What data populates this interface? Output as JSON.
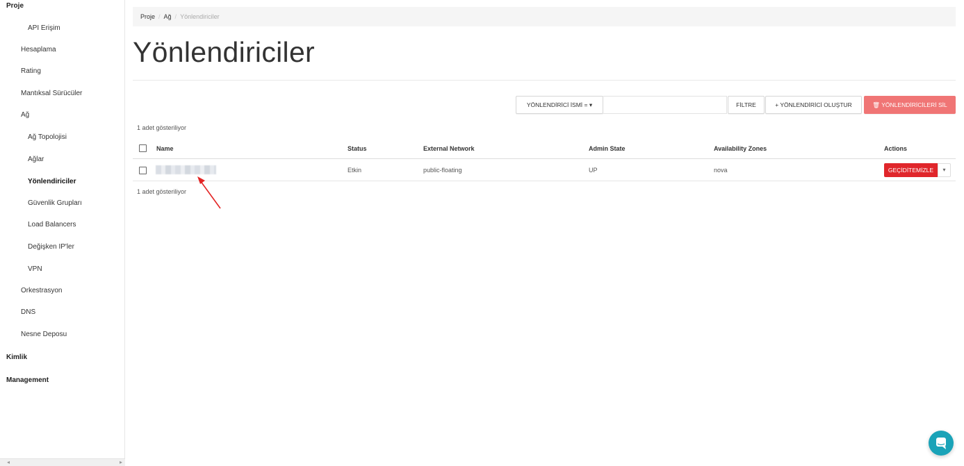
{
  "sidebar": {
    "section_project": "Proje",
    "items": [
      {
        "label": "API Erişim"
      },
      {
        "label": "Hesaplama"
      },
      {
        "label": "Rating"
      },
      {
        "label": "Mantıksal Sürücüler"
      },
      {
        "label": "Ağ"
      },
      {
        "label": "Ağ Topolojisi"
      },
      {
        "label": "Ağlar"
      },
      {
        "label": "Yönlendiriciler"
      },
      {
        "label": "Güvenlik Grupları"
      },
      {
        "label": "Load Balancers"
      },
      {
        "label": "Değişken IP'ler"
      },
      {
        "label": "VPN"
      },
      {
        "label": "Orkestrasyon"
      },
      {
        "label": "DNS"
      },
      {
        "label": "Nesne Deposu"
      }
    ],
    "section_identity": "Kimlik",
    "section_management": "Management"
  },
  "breadcrumb": {
    "items": [
      "Proje",
      "Ağ",
      "Yönlendiriciler"
    ],
    "separator": "/"
  },
  "page": {
    "title": "Yönlendiriciler",
    "count_top": "1 adet gösteriliyor",
    "count_bottom": "1 adet gösteriliyor"
  },
  "toolbar": {
    "filter_select_label": "YÖNLENDİRİCİ İSMİ = ▾",
    "filter_input_value": "",
    "filter_button": "FİLTRE",
    "create_button": "+ YÖNLENDİRİCİ OLUŞTUR",
    "delete_button": "🗑 YÖNLENDİRİCİLERİ SİL",
    "delete_color": "#f07575"
  },
  "table": {
    "columns": [
      "Name",
      "Status",
      "External Network",
      "Admin State",
      "Availability Zones",
      "Actions"
    ],
    "rows": [
      {
        "name": "",
        "status": "Etkin",
        "external_network": "public-floating",
        "admin_state": "UP",
        "availability_zones": "nova",
        "action_label": "GEÇİDİTEMİZLE",
        "action_caret": "▾"
      }
    ]
  },
  "colors": {
    "danger": "#e0262b",
    "chat": "#1aa3b8"
  },
  "icons": {
    "chat": "chat-bubble-icon",
    "annotation": "red-arrow-icon"
  }
}
